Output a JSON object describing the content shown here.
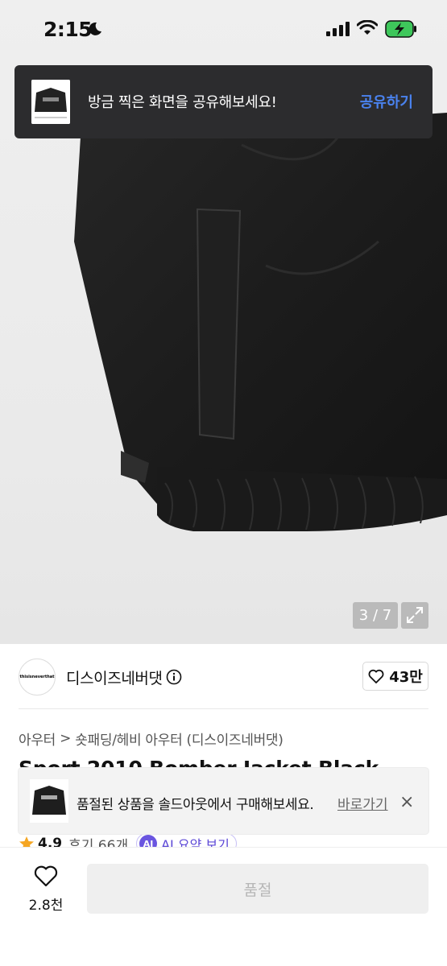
{
  "status_bar": {
    "time": "2:15"
  },
  "share_toast": {
    "message": "방금 찍은 화면을 공유해보세요!",
    "action": "공유하기"
  },
  "gallery": {
    "counter": "3 / 7"
  },
  "brand": {
    "logo_text": "thisisneverthat",
    "name": "디스이즈네버댓",
    "likes": "43만"
  },
  "breadcrumb": {
    "category": "아우터",
    "separator": ">",
    "subcategory": "숏패딩/헤비 아우터 (디스이즈네버댓)"
  },
  "product": {
    "title": "Sport 2010 Bomber Jacket Black"
  },
  "soldout_toast": {
    "message": "품절된 상품을 솔드아웃에서 구매해보세요.",
    "link": "바로가기",
    "close": "×"
  },
  "rating": {
    "score": "4.9",
    "reviews": "후기 66개",
    "ai_badge": "AI",
    "ai_label": "AI 요약 보기"
  },
  "bottom_bar": {
    "wish_count": "2.8천",
    "buy_label": "품절"
  }
}
